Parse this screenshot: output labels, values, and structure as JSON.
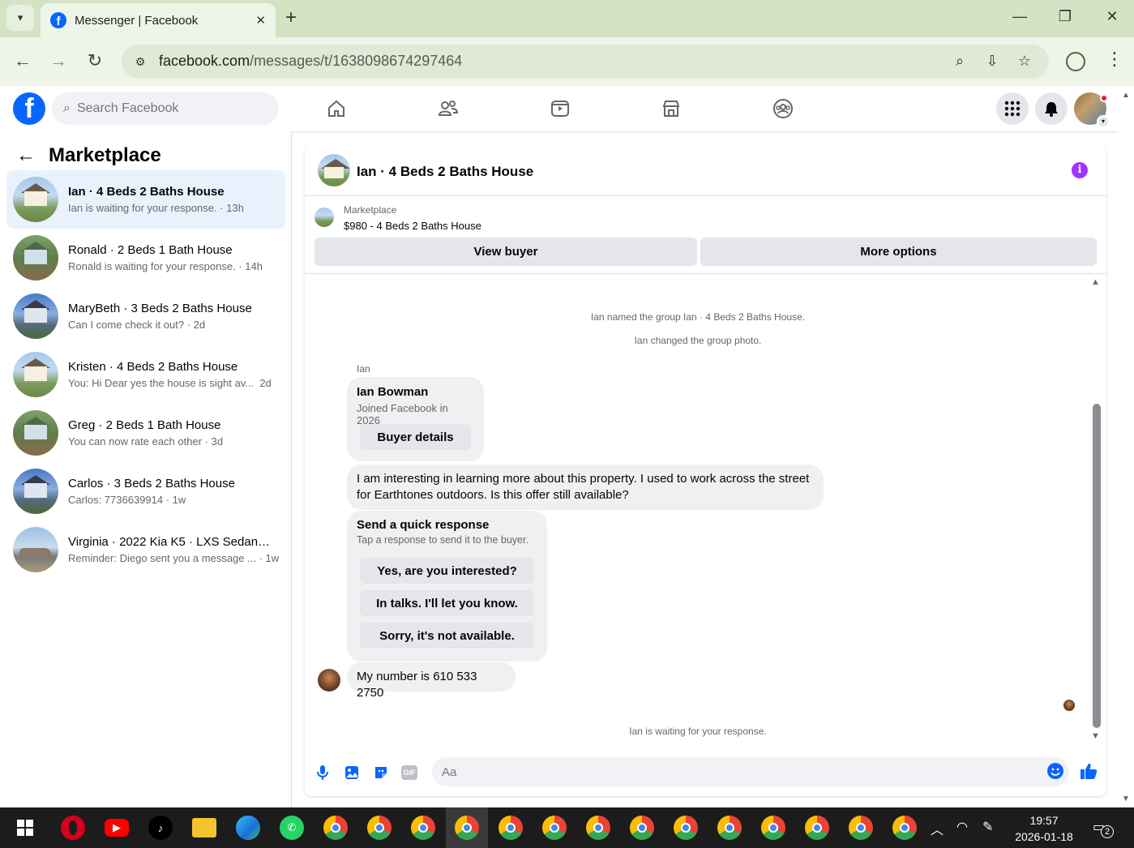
{
  "browser": {
    "tab_title": "Messenger | Facebook",
    "url_host": "facebook.com",
    "url_path": "/messages/t/1638098674297464",
    "new_tab_label": "+",
    "close_tab_label": "✕"
  },
  "fb_header": {
    "logo_letter": "f",
    "search_placeholder": "Search Facebook",
    "nav_icons": [
      "home-icon",
      "friends-icon",
      "video-icon",
      "marketplace-icon",
      "groups-icon"
    ]
  },
  "sidebar": {
    "title": "Marketplace",
    "conversations": [
      {
        "name": "Ian · 4 Beds 2 Baths House",
        "snippet": "Ian is waiting for your response.",
        "time": "· 13h",
        "active": true,
        "bold": true
      },
      {
        "name": "Ronald · 2 Beds 1 Bath House",
        "snippet": "Ronald is waiting for your response.",
        "time": "· 14h",
        "active": false,
        "bold": false
      },
      {
        "name": "MaryBeth · 3 Beds 2 Baths House",
        "snippet": "Can I come check it out?",
        "time": "· 2d",
        "active": false,
        "bold": false
      },
      {
        "name": "Kristen · 4 Beds 2 Baths House",
        "snippet": "You: Hi Dear yes the house is sight av...",
        "time": "2d",
        "active": false,
        "bold": false
      },
      {
        "name": "Greg · 2 Beds 1 Bath House",
        "snippet": "You can now rate each other",
        "time": "· 3d",
        "active": false,
        "bold": false
      },
      {
        "name": "Carlos · 3 Beds 2 Baths House",
        "snippet": "Carlos: 7736639914",
        "time": "· 1w",
        "active": false,
        "bold": false
      },
      {
        "name": "Virginia · 2022 Kia K5 · LXS Sedan ...",
        "snippet": "Reminder: Diego sent you a message ...",
        "time": "· 1w",
        "active": false,
        "bold": false
      }
    ]
  },
  "chat": {
    "title": "Ian · 4 Beds 2 Baths House",
    "listing_label": "Marketplace",
    "listing_price_title": "$980 - 4 Beds 2 Baths House",
    "view_buyer_label": "View buyer",
    "more_options_label": "More options",
    "system_messages": [
      "Ian named the group Ian · 4 Beds 2 Baths House.",
      "Ian changed the group photo."
    ],
    "sender_label": "Ian",
    "profile_card": {
      "name": "Ian Bowman",
      "joined": "Joined Facebook in 2026",
      "button": "Buyer details"
    },
    "message_1": "I am interesting in learning more about this property. I used to work across the street for Earthtones outdoors. Is this offer still available?",
    "quick_response": {
      "title": "Send a quick response",
      "subtitle": "Tap a response to send it to the buyer.",
      "options": [
        "Yes, are you interested?",
        "In talks. I'll let you know.",
        "Sorry, it's not available."
      ]
    },
    "message_2": "My number is 610 533 2750",
    "waiting_note": "Ian is waiting for your response.",
    "composer_placeholder": "Aa",
    "gif_label": "GIF"
  },
  "taskbar": {
    "time": "19:57",
    "date": "2026-01-18",
    "notification_count": "2"
  },
  "colors": {
    "fb_blue": "#0866ff",
    "active_conv_bg": "#e9f1fd",
    "info_purple": "#a033ff",
    "chrome_green": "#d3e3c4"
  }
}
